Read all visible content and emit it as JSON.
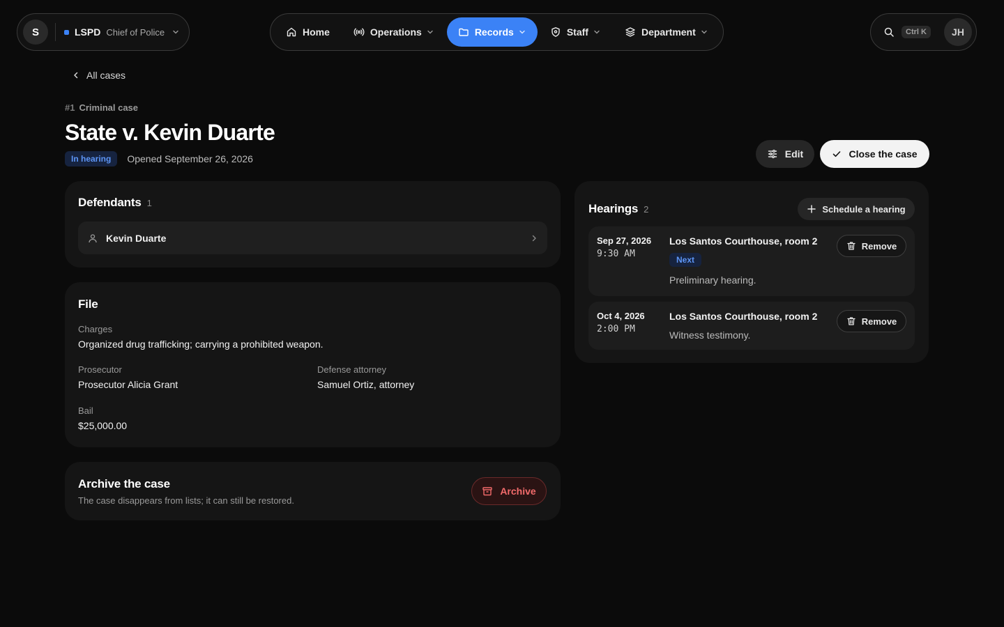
{
  "topbar": {
    "org": {
      "initial": "S",
      "name": "LSPD",
      "role": "Chief of Police"
    },
    "nav": [
      {
        "label": "Home",
        "icon": "home-icon"
      },
      {
        "label": "Operations",
        "icon": "broadcast-icon"
      },
      {
        "label": "Records",
        "icon": "folder-icon",
        "active": true
      },
      {
        "label": "Staff",
        "icon": "shield-icon"
      },
      {
        "label": "Department",
        "icon": "layers-icon"
      }
    ],
    "search_shortcut": "Ctrl K",
    "user_initials": "JH"
  },
  "back_link": "All cases",
  "case": {
    "number": "#1",
    "type": "Criminal case",
    "title": "State v. Kevin Duarte",
    "status": "In hearing",
    "opened": "Opened September 26, 2026"
  },
  "actions": {
    "edit": "Edit",
    "close": "Close the case"
  },
  "defendants": {
    "title": "Defendants",
    "count": "1",
    "items": [
      {
        "name": "Kevin Duarte"
      }
    ]
  },
  "file": {
    "title": "File",
    "charges_label": "Charges",
    "charges": "Organized drug trafficking; carrying a prohibited weapon.",
    "prosecutor_label": "Prosecutor",
    "prosecutor": "Prosecutor Alicia Grant",
    "defense_label": "Defense attorney",
    "defense": "Samuel Ortiz, attorney",
    "bail_label": "Bail",
    "bail": "$25,000.00"
  },
  "archive": {
    "title": "Archive the case",
    "description": "The case disappears from lists; it can still be restored.",
    "button": "Archive"
  },
  "hearings": {
    "title": "Hearings",
    "count": "2",
    "schedule_button": "Schedule a hearing",
    "remove_label": "Remove",
    "items": [
      {
        "date": "Sep 27, 2026",
        "time": "9:30 AM",
        "location": "Los Santos Courthouse, room 2",
        "badge": "Next",
        "description": "Preliminary hearing."
      },
      {
        "date": "Oct 4, 2026",
        "time": "2:00 PM",
        "location": "Los Santos Courthouse, room 2",
        "description": "Witness testimony."
      }
    ]
  },
  "colors": {
    "accent": "#3b82f6",
    "danger": "#f26b6b",
    "background": "#0b0b0b",
    "card": "#151515"
  }
}
